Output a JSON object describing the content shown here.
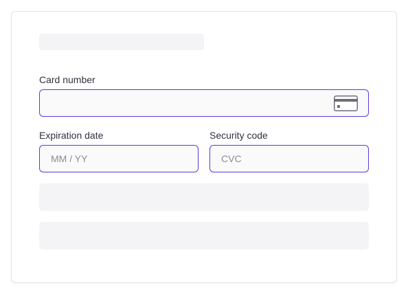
{
  "form": {
    "card_number": {
      "label": "Card number",
      "value": "",
      "icon": "credit-card-icon"
    },
    "expiration": {
      "label": "Expiration date",
      "placeholder": "MM / YY",
      "value": ""
    },
    "security_code": {
      "label": "Security code",
      "placeholder": "CVC",
      "value": ""
    }
  },
  "colors": {
    "focus_border": "#5c36e0",
    "field_background": "#fafafa",
    "skeleton": "#f4f4f6",
    "label_text": "#30313d",
    "placeholder_text": "#8a8c99"
  }
}
